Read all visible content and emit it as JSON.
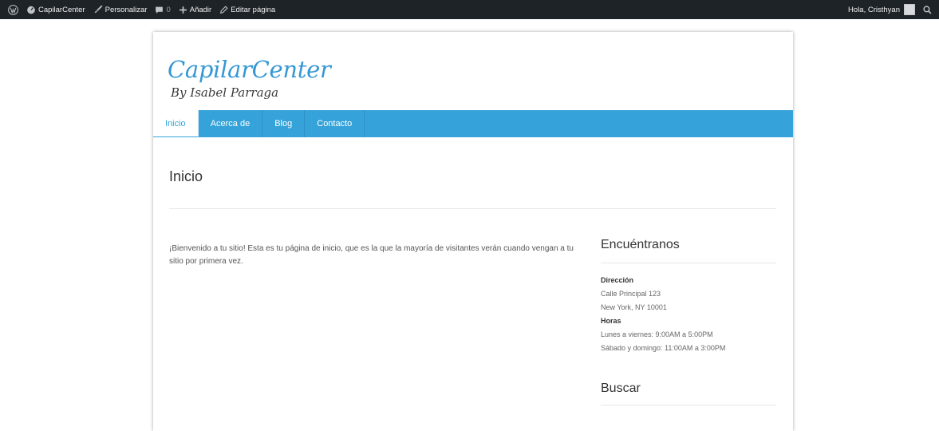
{
  "admin_bar": {
    "site_name": "CapilarCenter",
    "customize_label": "Personalizar",
    "comments_count": "0",
    "add_label": "Añadir",
    "edit_label": "Editar página",
    "greeting": "Hola, Cristhyan",
    "icons": [
      "wordpress-icon",
      "dashboard-icon",
      "brush-icon",
      "comment-icon",
      "plus-icon",
      "pencil-icon",
      "avatar",
      "search-icon"
    ]
  },
  "site": {
    "logo_title": "CapilarCenter",
    "logo_subtitle": "By Isabel Parraga",
    "accent_color": "#35a3da"
  },
  "nav": {
    "items": [
      {
        "label": "Inicio",
        "active": true
      },
      {
        "label": "Acerca de"
      },
      {
        "label": "Blog"
      },
      {
        "label": "Contacto"
      }
    ]
  },
  "page": {
    "title": "Inicio",
    "body": "¡Bienvenido a tu sitio! Esta es tu página de inicio, que es la que la mayoría de visitantes verán cuando vengan a tu sitio por primera vez."
  },
  "sidebar": {
    "find_us_title": "Encuéntranos",
    "address_label": "Dirección",
    "address_line1": "Calle Principal 123",
    "address_line2": "New York, NY 10001",
    "hours_label": "Horas",
    "hours_line1": "Lunes a viernes: 9:00AM a 5:00PM",
    "hours_line2": "Sábado y domingo: 11:00AM a 3:00PM",
    "search_title": "Buscar"
  }
}
